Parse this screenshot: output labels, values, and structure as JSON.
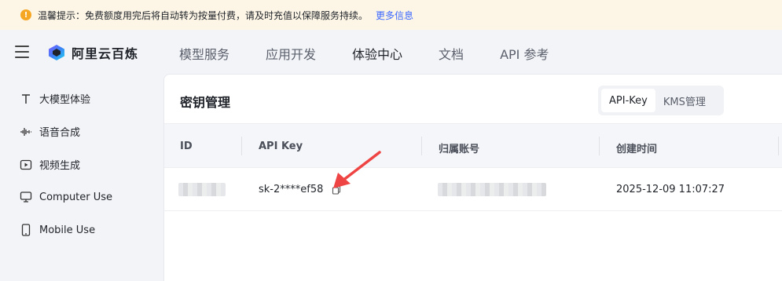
{
  "notice": {
    "icon": "warning-icon",
    "text": "温馨提示：免费额度用完后将自动转为按量付费，请及时充值以保障服务持续。",
    "link": "更多信息",
    "colors": {
      "background": "#fdf6e6",
      "icon": "#f5a623",
      "link": "#3b67ff"
    }
  },
  "header": {
    "logo_text": "阿里云百炼",
    "nav": [
      {
        "label": "模型服务",
        "active": false
      },
      {
        "label": "应用开发",
        "active": false
      },
      {
        "label": "体验中心",
        "active": true
      },
      {
        "label": "文档",
        "active": false
      },
      {
        "label": "API 参考",
        "active": false
      }
    ]
  },
  "sidebar": {
    "items": [
      {
        "label": "大模型体验",
        "icon": "text-t-icon"
      },
      {
        "label": "语音合成",
        "icon": "waveform-icon"
      },
      {
        "label": "视频生成",
        "icon": "video-play-icon"
      },
      {
        "label": "Computer Use",
        "icon": "monitor-icon"
      },
      {
        "label": "Mobile Use",
        "icon": "mobile-icon"
      }
    ]
  },
  "main": {
    "title": "密钥管理",
    "tabs": [
      {
        "label": "API-Key",
        "active": true
      },
      {
        "label": "KMS管理",
        "active": false
      }
    ],
    "table": {
      "columns": [
        "ID",
        "API Key",
        "归属账号",
        "创建时间"
      ],
      "rows": [
        {
          "id": "",
          "api_key": "sk-2****ef58",
          "account": "",
          "created_at": "2025-12-09 11:07:27"
        }
      ]
    }
  },
  "annotation": {
    "color": "#ef4444",
    "shape": "arrow-pointing-to-copy-icon"
  }
}
